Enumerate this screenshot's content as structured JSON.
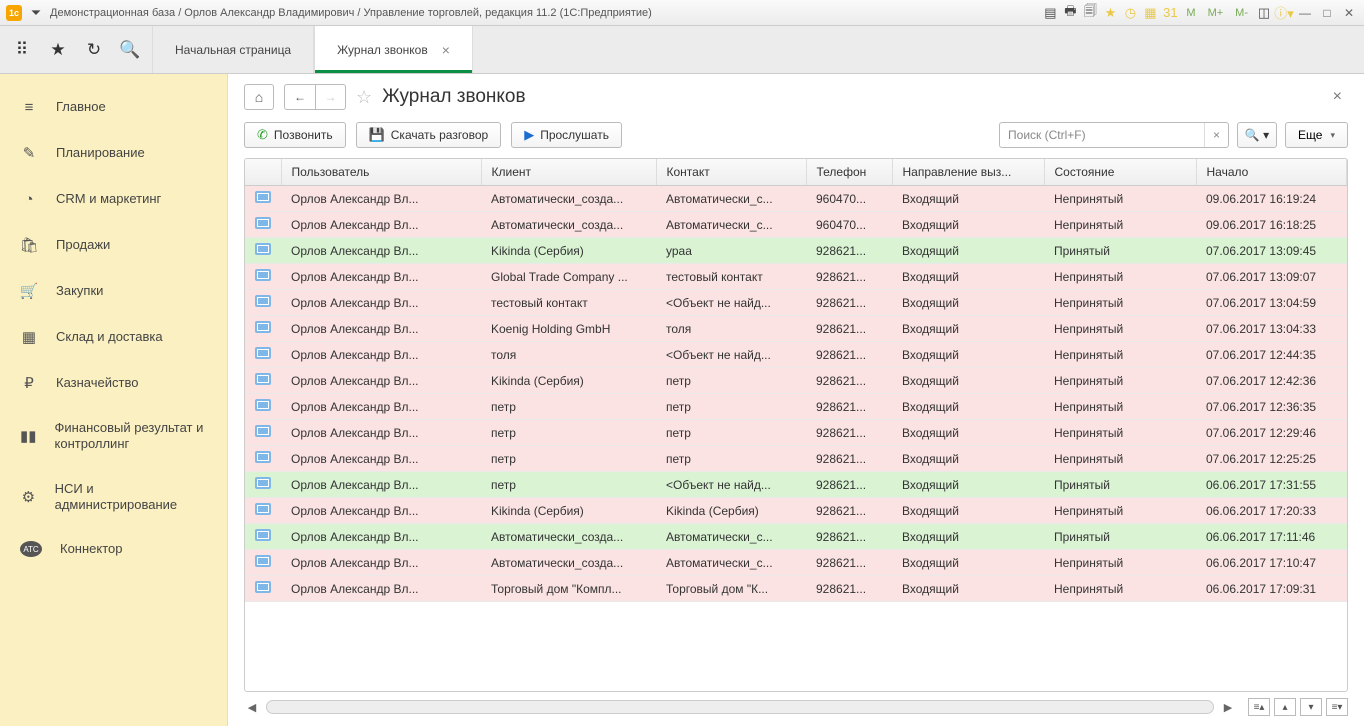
{
  "titlebar": {
    "text": "Демонстрационная база / Орлов Александр Владимирович / Управление торговлей, редакция 11.2  (1С:Предприятие)",
    "m_btn1": "M",
    "m_btn2": "M+",
    "m_btn3": "M-"
  },
  "tabs": {
    "home": "Начальная страница",
    "active": "Журнал звонков"
  },
  "sidebar": {
    "items": [
      {
        "icon": "≡",
        "label": "Главное"
      },
      {
        "icon": "✎",
        "label": "Планирование"
      },
      {
        "icon": "◔",
        "label": "CRM и маркетинг"
      },
      {
        "icon": "🛍",
        "label": "Продажи"
      },
      {
        "icon": "🛒",
        "label": "Закупки"
      },
      {
        "icon": "▦",
        "label": "Склад и доставка"
      },
      {
        "icon": "₽",
        "label": "Казначейство"
      },
      {
        "icon": "▮▮",
        "label": "Финансовый результат и контроллинг"
      },
      {
        "icon": "⚙",
        "label": "НСИ и администрирование"
      },
      {
        "icon": "АТС",
        "label": "Коннектор"
      }
    ]
  },
  "page": {
    "title": "Журнал звонков"
  },
  "toolbar": {
    "call": "Позвонить",
    "download": "Скачать разговор",
    "play": "Прослушать",
    "search_placeholder": "Поиск (Ctrl+F)",
    "more": "Еще"
  },
  "columns": [
    "Пользователь",
    "Клиент",
    "Контакт",
    "Телефон",
    "Направление выз...",
    "Состояние",
    "Начало"
  ],
  "rows": [
    {
      "status": "red",
      "user": "Орлов Александр Вл...",
      "client": "Автоматически_созда...",
      "contact": "Автоматически_с...",
      "phone": "960470...",
      "dir": "Входящий",
      "state": "Непринятый",
      "start": "09.06.2017 16:19:24"
    },
    {
      "status": "red",
      "user": "Орлов Александр Вл...",
      "client": "Автоматически_созда...",
      "contact": "Автоматически_с...",
      "phone": "960470...",
      "dir": "Входящий",
      "state": "Непринятый",
      "start": "09.06.2017 16:18:25"
    },
    {
      "status": "green",
      "user": "Орлов Александр Вл...",
      "client": "Kikinda (Сербия)",
      "contact": "ураа",
      "phone": "928621...",
      "dir": "Входящий",
      "state": "Принятый",
      "start": "07.06.2017 13:09:45"
    },
    {
      "status": "red",
      "user": "Орлов Александр Вл...",
      "client": "Global Trade Company ...",
      "contact": "тестовый контакт",
      "phone": "928621...",
      "dir": "Входящий",
      "state": "Непринятый",
      "start": "07.06.2017 13:09:07"
    },
    {
      "status": "red",
      "user": "Орлов Александр Вл...",
      "client": "тестовый контакт",
      "contact": "<Объект не найд...",
      "phone": "928621...",
      "dir": "Входящий",
      "state": "Непринятый",
      "start": "07.06.2017 13:04:59"
    },
    {
      "status": "red",
      "user": "Орлов Александр Вл...",
      "client": "Koenig Holding GmbH",
      "contact": "толя",
      "phone": "928621...",
      "dir": "Входящий",
      "state": "Непринятый",
      "start": "07.06.2017 13:04:33"
    },
    {
      "status": "red",
      "user": "Орлов Александр Вл...",
      "client": "толя",
      "contact": "<Объект не найд...",
      "phone": "928621...",
      "dir": "Входящий",
      "state": "Непринятый",
      "start": "07.06.2017 12:44:35"
    },
    {
      "status": "red",
      "user": "Орлов Александр Вл...",
      "client": "Kikinda (Сербия)",
      "contact": "петр",
      "phone": "928621...",
      "dir": "Входящий",
      "state": "Непринятый",
      "start": "07.06.2017 12:42:36"
    },
    {
      "status": "red",
      "user": "Орлов Александр Вл...",
      "client": "петр",
      "contact": "петр",
      "phone": "928621...",
      "dir": "Входящий",
      "state": "Непринятый",
      "start": "07.06.2017 12:36:35"
    },
    {
      "status": "red",
      "user": "Орлов Александр Вл...",
      "client": "петр",
      "contact": "петр",
      "phone": "928621...",
      "dir": "Входящий",
      "state": "Непринятый",
      "start": "07.06.2017 12:29:46"
    },
    {
      "status": "red",
      "user": "Орлов Александр Вл...",
      "client": "петр",
      "contact": "петр",
      "phone": "928621...",
      "dir": "Входящий",
      "state": "Непринятый",
      "start": "07.06.2017 12:25:25"
    },
    {
      "status": "green",
      "user": "Орлов Александр Вл...",
      "client": "петр",
      "contact": "<Объект не найд...",
      "phone": "928621...",
      "dir": "Входящий",
      "state": "Принятый",
      "start": "06.06.2017 17:31:55"
    },
    {
      "status": "red",
      "user": "Орлов Александр Вл...",
      "client": "Kikinda (Сербия)",
      "contact": "Kikinda (Сербия)",
      "phone": "928621...",
      "dir": "Входящий",
      "state": "Непринятый",
      "start": "06.06.2017 17:20:33"
    },
    {
      "status": "green",
      "user": "Орлов Александр Вл...",
      "client": "Автоматически_созда...",
      "contact": "Автоматически_с...",
      "phone": "928621...",
      "dir": "Входящий",
      "state": "Принятый",
      "start": "06.06.2017 17:11:46"
    },
    {
      "status": "red",
      "user": "Орлов Александр Вл...",
      "client": "Автоматически_созда...",
      "contact": "Автоматически_с...",
      "phone": "928621...",
      "dir": "Входящий",
      "state": "Непринятый",
      "start": "06.06.2017 17:10:47"
    },
    {
      "status": "red",
      "user": "Орлов Александр Вл...",
      "client": "Торговый дом \"Компл...",
      "contact": "Торговый дом \"К...",
      "phone": "928621...",
      "dir": "Входящий",
      "state": "Непринятый",
      "start": "06.06.2017 17:09:31"
    }
  ]
}
